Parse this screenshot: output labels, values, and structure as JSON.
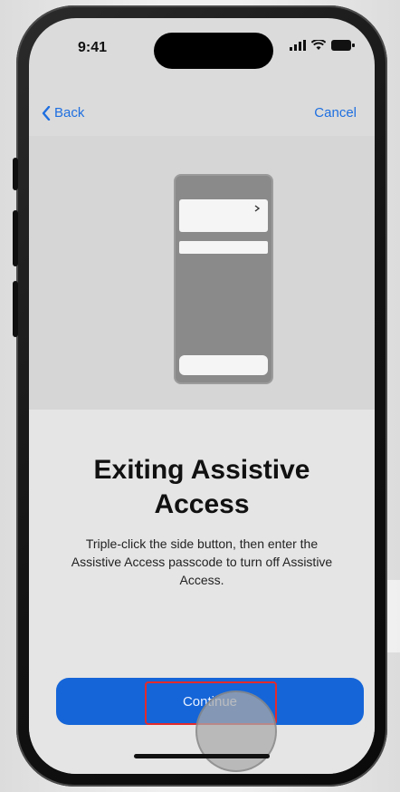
{
  "status": {
    "time": "9:41"
  },
  "nav": {
    "back_label": "Back",
    "cancel_label": "Cancel"
  },
  "main": {
    "title_line1": "Exiting Assistive",
    "title_line2": "Access",
    "description": "Triple-click the side button, then enter the Assistive Access passcode to turn off Assistive Access.",
    "continue_label": "Continue"
  },
  "icons": {
    "back": "chevron-left-icon",
    "signal": "cellular-signal-icon",
    "wifi": "wifi-icon",
    "battery": "battery-icon"
  },
  "colors": {
    "accent": "#1e6fe0",
    "button": "#1565d8",
    "highlight": "#e32b2b"
  }
}
